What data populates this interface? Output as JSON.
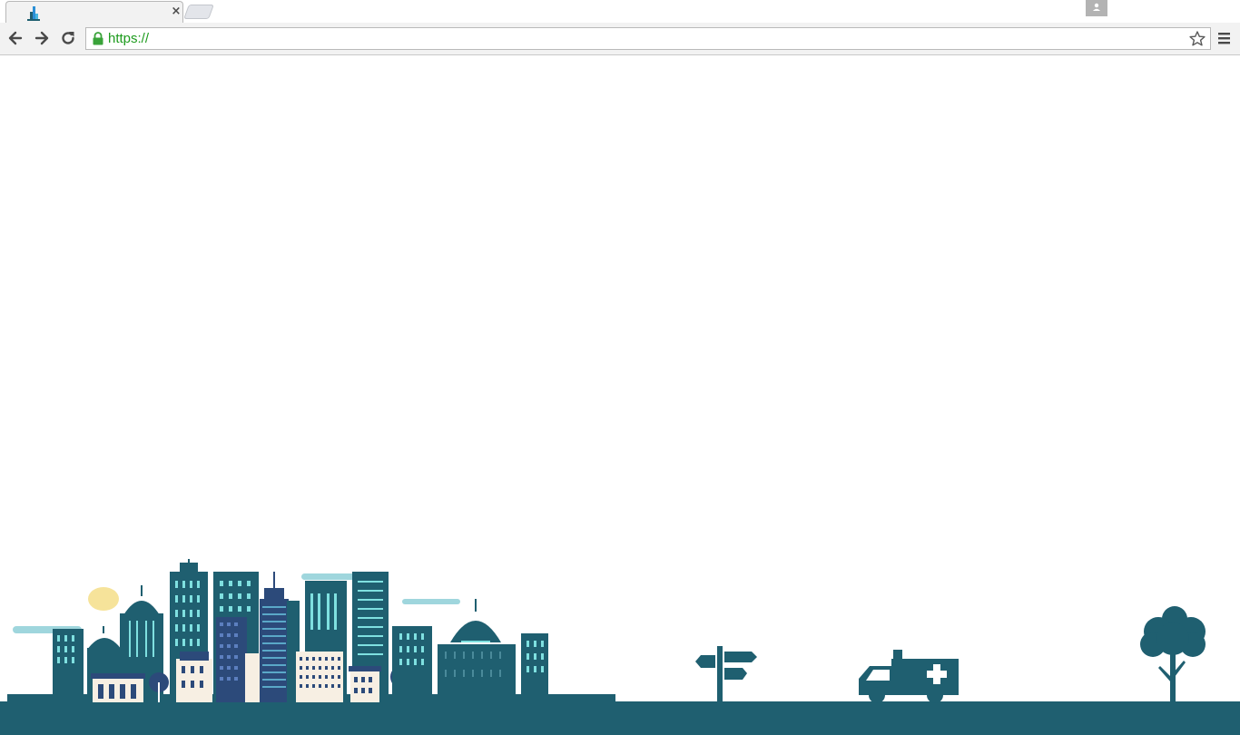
{
  "browser": {
    "active_tab": {
      "title": "",
      "close_glyph": "×"
    },
    "address_bar": {
      "url": "https://"
    },
    "icons": {
      "back": "back-arrow-icon",
      "forward": "forward-arrow-icon",
      "reload": "reload-icon",
      "lock": "lock-icon",
      "bookmark": "star-icon",
      "menu": "menu-icon",
      "profile": "profile-avatar-icon"
    }
  },
  "colors": {
    "skyline_dark": "#1f5f70",
    "skyline_navy": "#2c4a7a",
    "window_light": "#7fe0e0",
    "cream": "#f7efe3",
    "sun": "#f6e39a",
    "cloud": "#9fd6dd",
    "url_green": "#1d9b1d"
  }
}
